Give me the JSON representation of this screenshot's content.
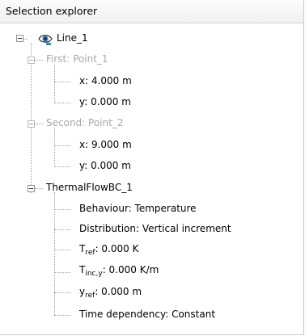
{
  "panel": {
    "title": "Selection explorer"
  },
  "tree": {
    "root": {
      "label": "Line_1",
      "icon": "eye-icon"
    },
    "first": {
      "label": "First: Point_1",
      "x": "x: 4.000 m",
      "y": "y: 0.000 m"
    },
    "second": {
      "label": "Second: Point_2",
      "x": "x: 9.000 m",
      "y": "y: 0.000 m"
    },
    "bc": {
      "label": "ThermalFlowBC_1",
      "behaviour": "Behaviour: Temperature",
      "distribution": "Distribution: Vertical increment",
      "t_ref_base": "T",
      "t_ref_sub": "ref",
      "t_ref_value": ": 0.000 K",
      "t_inc_base": "T",
      "t_inc_sub": "inc,y",
      "t_inc_value": ": 0.000 K/m",
      "y_ref_base": "y",
      "y_ref_sub": "ref",
      "y_ref_value": ": 0.000 m",
      "time_dependency": "Time dependency: Constant"
    }
  },
  "colors": {
    "dim_text": "#a8a8a8",
    "eye_blue": "#3a78c3",
    "eye_teal": "#2a9aa0"
  }
}
